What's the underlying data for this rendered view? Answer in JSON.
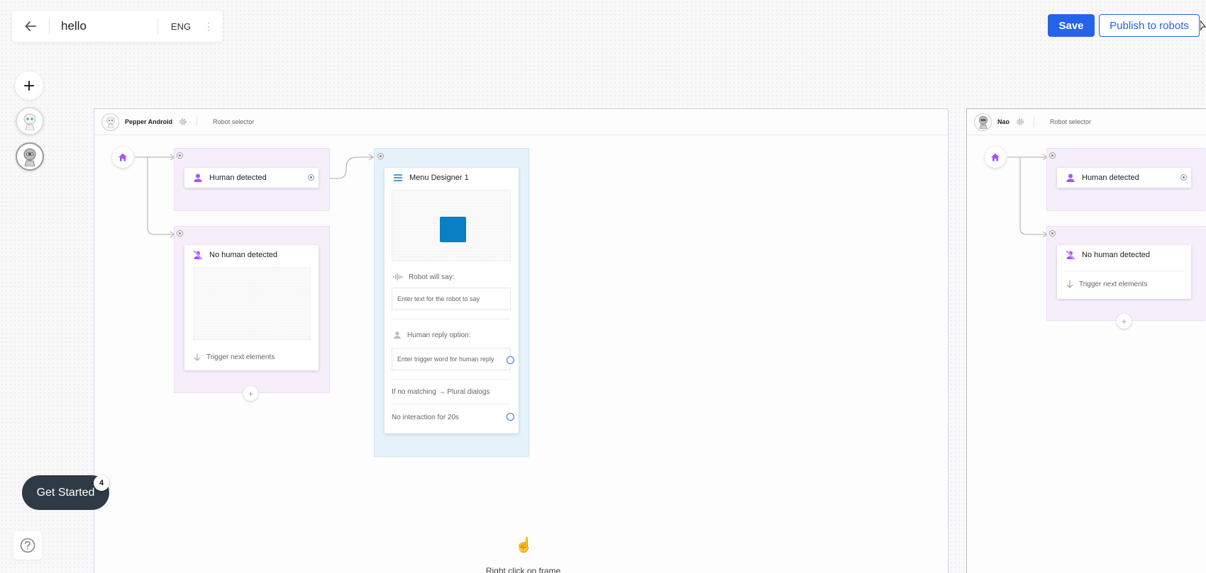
{
  "header": {
    "title": "hello",
    "language": "ENG",
    "save_label": "Save",
    "publish_label": "Publish to robots"
  },
  "colors": {
    "primary": "#2563eb",
    "accent_purple": "#a855f7",
    "menu_blue": "#0a7fc4",
    "dark": "#2e3a45"
  },
  "left_toolbar": {
    "add_icon": "plus-icon",
    "robots": [
      "pepper-avatar",
      "nao-avatar"
    ]
  },
  "frames": [
    {
      "robot": "Pepper Android",
      "selector": "Robot selector",
      "human_detected": "Human detected",
      "no_human_detected": "No human detected",
      "trigger": "Trigger next elements",
      "menu": {
        "title": "Menu Designer 1",
        "robot_say_label": "Robot will say:",
        "robot_say_placeholder": "Enter text for the robot to say",
        "human_reply_label": "Human reply option:",
        "human_reply_placeholder": "Enter trigger word for human reply",
        "no_match": "If no matching → Plural dialogs",
        "no_interaction": "No interaction for 20s"
      }
    },
    {
      "robot": "Nao",
      "selector": "Robot selector",
      "human_detected": "Human detected",
      "no_human_detected": "No human detected",
      "trigger": "Trigger next elements"
    }
  ],
  "get_started": {
    "label": "Get Started",
    "badge": "4"
  },
  "hint": {
    "text": "Right click on frame",
    "icon": "pointing-hand-icon"
  }
}
